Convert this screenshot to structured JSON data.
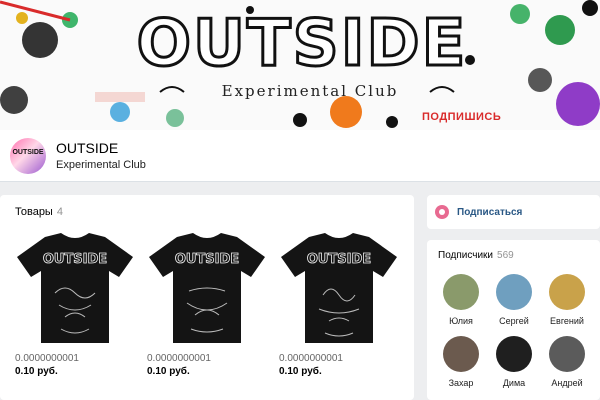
{
  "cover": {
    "logo": "OUTSIDE",
    "tagline": "Experimental Club",
    "cta": "ПОДПИШИСЬ"
  },
  "group": {
    "avatar_text": "OUTSIDE",
    "name": "OUTSIDE",
    "status": "Experimental Club"
  },
  "products": {
    "title": "Товары",
    "count": "4",
    "items": [
      {
        "shirt_text": "OUTSIDE",
        "code": "0.0000000001",
        "price": "0.10 руб."
      },
      {
        "shirt_text": "OUTSIDE",
        "code": "0.0000000001",
        "price": "0.10 руб."
      },
      {
        "shirt_text": "OUTSIDE",
        "code": "0.0000000001",
        "price": "0.10 руб."
      }
    ]
  },
  "subscribe": {
    "label": "Подписаться"
  },
  "members": {
    "title": "Подписчики",
    "count": "569",
    "list": [
      {
        "name": "Юлия",
        "color": "#8a9a6b"
      },
      {
        "name": "Сергей",
        "color": "#6f9fbf"
      },
      {
        "name": "Евгений",
        "color": "#c9a24a"
      },
      {
        "name": "Захар",
        "color": "#6b5a4e"
      },
      {
        "name": "Дима",
        "color": "#1f1f1f"
      },
      {
        "name": "Андрей",
        "color": "#5b5b5b"
      }
    ]
  },
  "colors": {
    "accent": "#2a5885",
    "cta_red": "#d92b2b",
    "bg": "#edeef0"
  }
}
